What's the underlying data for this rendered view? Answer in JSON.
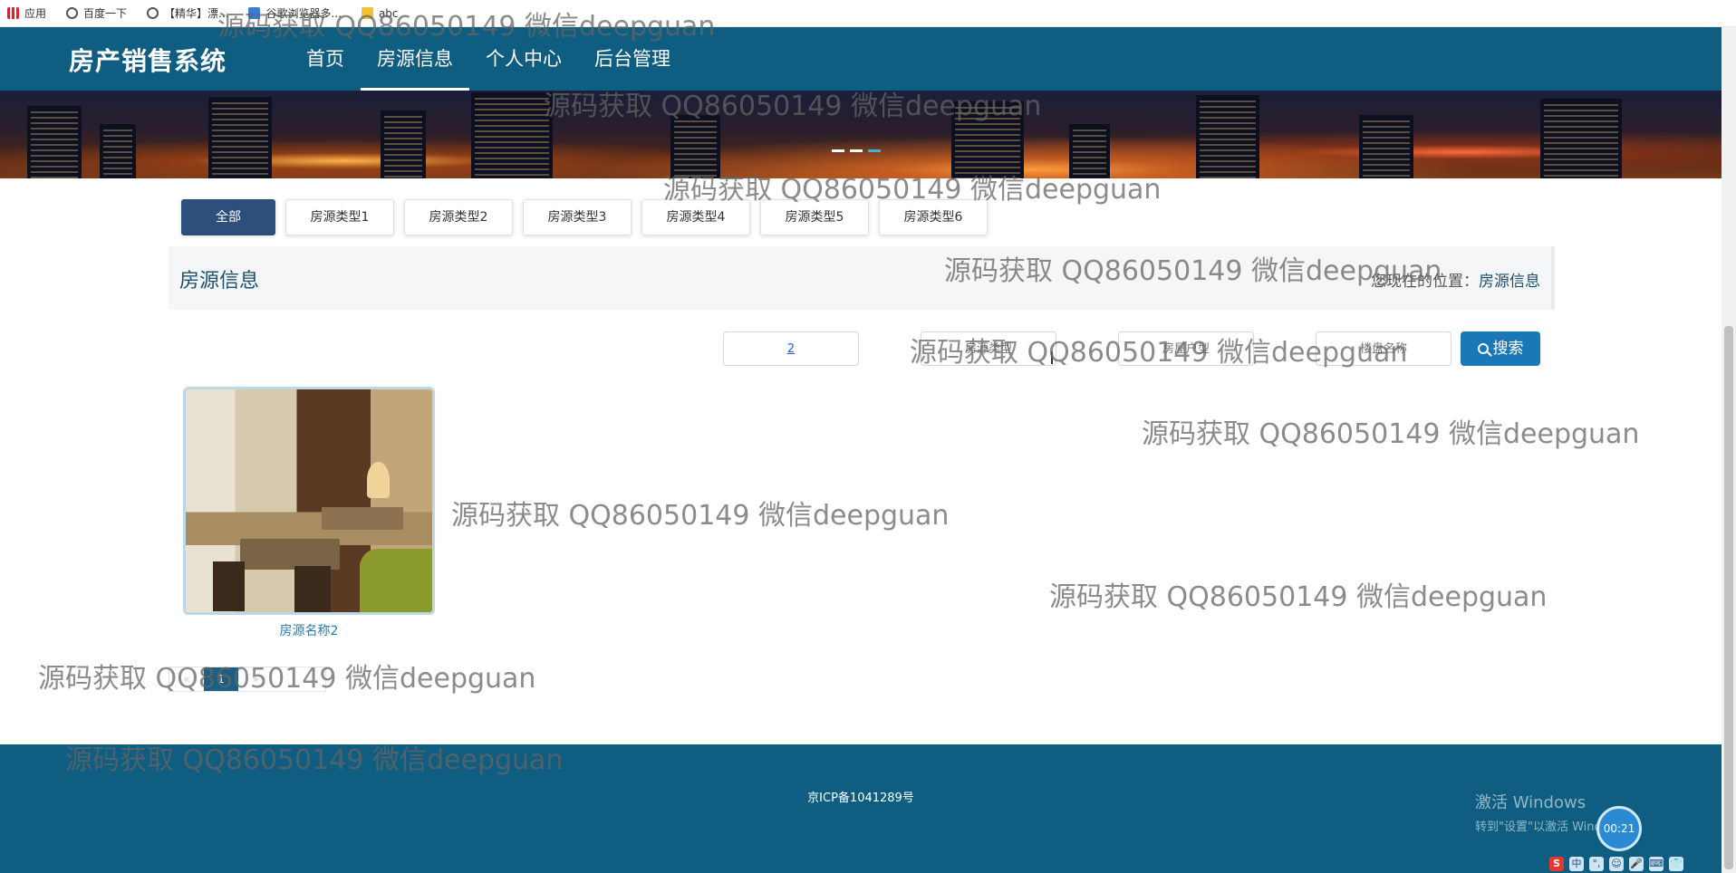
{
  "browser": {
    "bookmarks": [
      {
        "label": "应用",
        "icon": "apps-grid-icon"
      },
      {
        "label": "百度一下",
        "icon": "globe-icon"
      },
      {
        "label": "【精华】漂...",
        "icon": "globe-icon"
      },
      {
        "label": "谷歌浏览器多...",
        "icon": "doc-icon"
      },
      {
        "label": "abc",
        "icon": "folder-icon"
      }
    ]
  },
  "nav": {
    "brand": "房产销售系统",
    "items": [
      {
        "label": "首页"
      },
      {
        "label": "房源信息",
        "active": true
      },
      {
        "label": "个人中心"
      },
      {
        "label": "后台管理"
      }
    ]
  },
  "banner": {
    "slide_count": 3,
    "active_slide": 3
  },
  "categories": [
    {
      "label": "全部",
      "active": true
    },
    {
      "label": "房源类型1"
    },
    {
      "label": "房源类型2"
    },
    {
      "label": "房源类型3"
    },
    {
      "label": "房源类型4"
    },
    {
      "label": "房源类型5"
    },
    {
      "label": "房源类型6"
    }
  ],
  "section": {
    "title": "房源信息",
    "location_prefix": "您现在的位置：",
    "location_current": "房源信息"
  },
  "search": {
    "field1_value": "2",
    "field2_placeholder": "房源类型",
    "field3_placeholder": "房屋户型",
    "field4_placeholder": "楼盘名称",
    "button_label": "搜索"
  },
  "listing": {
    "items": [
      {
        "name": "房源名称2",
        "image": "restaurant-interior-photo"
      }
    ]
  },
  "pagination": {
    "prev": "«",
    "current": "1",
    "next": "»"
  },
  "footer": {
    "icp": "京ICP备1041289号"
  },
  "windows": {
    "activate_title": "激活 Windows",
    "activate_sub": "转到\"设置\"以激活 Windows。",
    "timer": "00:21",
    "tray": [
      "S",
      "中",
      "°,",
      "☺",
      "🎤",
      "⌨",
      "👕"
    ]
  },
  "watermark": "源码获取 QQ86050149 微信deepguan",
  "colors": {
    "primary": "#0f5d80",
    "active_tab": "#2c4f7c",
    "search_button": "#1a78b8",
    "page_active": "#1a5f86"
  }
}
